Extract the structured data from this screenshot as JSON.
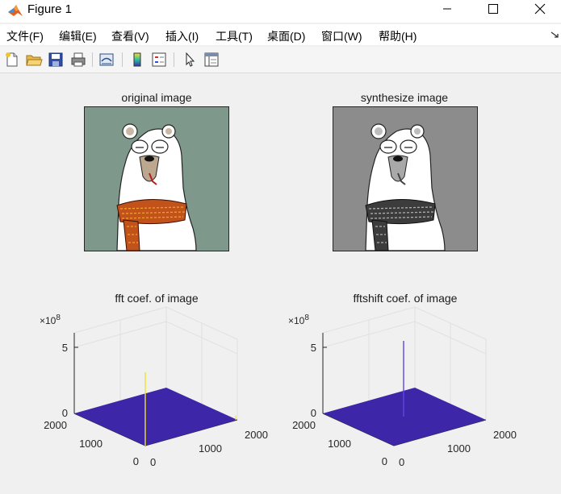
{
  "window": {
    "title": "Figure 1",
    "controls": [
      "minimize",
      "maximize",
      "close"
    ]
  },
  "menu": [
    "文件(F)",
    "编辑(E)",
    "查看(V)",
    "插入(I)",
    "工具(T)",
    "桌面(D)",
    "窗口(W)",
    "帮助(H)"
  ],
  "toolbar": [
    "new-figure-icon",
    "open-file-icon",
    "save-icon",
    "print-icon",
    "link-plot-icon",
    "colorbar-icon",
    "legend-icon",
    "pointer-icon",
    "property-inspector-icon"
  ],
  "subplots": {
    "original": {
      "title": "original image"
    },
    "synth": {
      "title": "synthesize image"
    },
    "fft": {
      "title": "fft coef. of image",
      "scale": "×10",
      "exponent": "8",
      "z_ticks": [
        "0",
        "5"
      ],
      "y_ticks": [
        "0",
        "1000",
        "2000"
      ],
      "x_ticks": [
        "0",
        "1000",
        "2000"
      ]
    },
    "fftshift": {
      "title": "fftshift coef. of image",
      "scale": "×10",
      "exponent": "8",
      "z_ticks": [
        "0",
        "5"
      ],
      "y_ticks": [
        "0",
        "1000",
        "2000"
      ],
      "x_ticks": [
        "0",
        "1000",
        "2000"
      ]
    }
  },
  "colors": {
    "surface": "#3d26a8",
    "original_bg": "#7e988b",
    "synth_bg": "#8c8c8c",
    "scarf": "#c0521a",
    "spike_fft": "#f0e030",
    "spike_shift": "#5a48e0"
  }
}
